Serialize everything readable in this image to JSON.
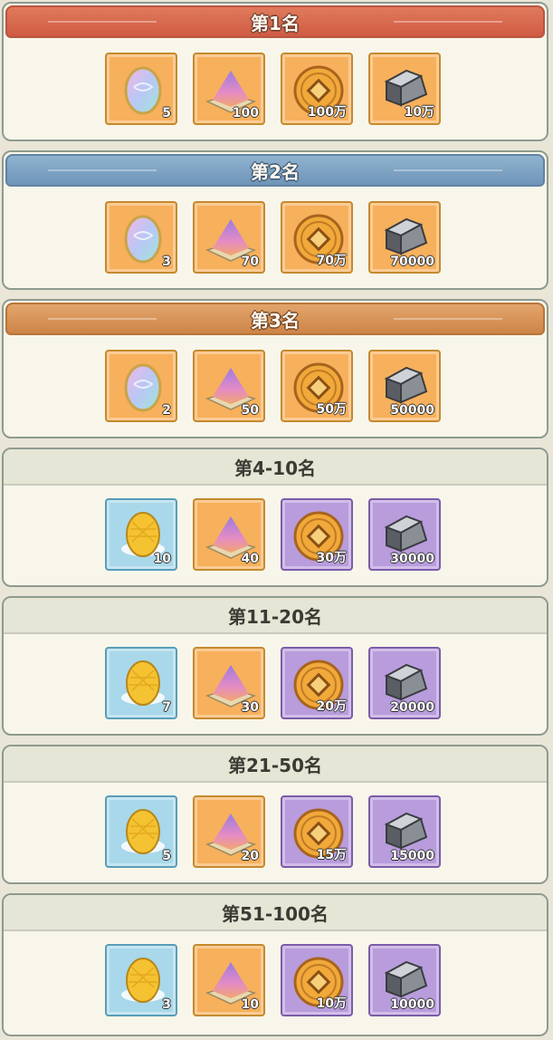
{
  "ranks": [
    {
      "title": "第1名",
      "style": "gold",
      "items": [
        {
          "icon": "rainbow-egg-icon",
          "bg": "orange",
          "qty": "5"
        },
        {
          "icon": "crystal-pile-icon",
          "bg": "orange",
          "qty": "100"
        },
        {
          "icon": "copper-coin-icon",
          "bg": "orange",
          "qty": "100万"
        },
        {
          "icon": "iron-ore-icon",
          "bg": "orange",
          "qty": "10万"
        }
      ]
    },
    {
      "title": "第2名",
      "style": "silver",
      "items": [
        {
          "icon": "rainbow-egg-icon",
          "bg": "orange",
          "qty": "3"
        },
        {
          "icon": "crystal-pile-icon",
          "bg": "orange",
          "qty": "70"
        },
        {
          "icon": "copper-coin-icon",
          "bg": "orange",
          "qty": "70万"
        },
        {
          "icon": "iron-ore-icon",
          "bg": "orange",
          "qty": "70000"
        }
      ]
    },
    {
      "title": "第3名",
      "style": "bronze",
      "items": [
        {
          "icon": "rainbow-egg-icon",
          "bg": "orange",
          "qty": "2"
        },
        {
          "icon": "crystal-pile-icon",
          "bg": "orange",
          "qty": "50"
        },
        {
          "icon": "copper-coin-icon",
          "bg": "orange",
          "qty": "50万"
        },
        {
          "icon": "iron-ore-icon",
          "bg": "orange",
          "qty": "50000"
        }
      ]
    },
    {
      "title": "第4-10名",
      "style": "plain",
      "items": [
        {
          "icon": "golden-egg-icon",
          "bg": "blue",
          "qty": "10"
        },
        {
          "icon": "crystal-pile-icon",
          "bg": "orange",
          "qty": "40"
        },
        {
          "icon": "copper-coin-icon",
          "bg": "purple",
          "qty": "30万"
        },
        {
          "icon": "iron-ore-icon",
          "bg": "purple",
          "qty": "30000"
        }
      ]
    },
    {
      "title": "第11-20名",
      "style": "plain",
      "items": [
        {
          "icon": "golden-egg-icon",
          "bg": "blue",
          "qty": "7"
        },
        {
          "icon": "crystal-pile-icon",
          "bg": "orange",
          "qty": "30"
        },
        {
          "icon": "copper-coin-icon",
          "bg": "purple",
          "qty": "20万"
        },
        {
          "icon": "iron-ore-icon",
          "bg": "purple",
          "qty": "20000"
        }
      ]
    },
    {
      "title": "第21-50名",
      "style": "plain",
      "items": [
        {
          "icon": "golden-egg-icon",
          "bg": "blue",
          "qty": "5"
        },
        {
          "icon": "crystal-pile-icon",
          "bg": "orange",
          "qty": "20"
        },
        {
          "icon": "copper-coin-icon",
          "bg": "purple",
          "qty": "15万"
        },
        {
          "icon": "iron-ore-icon",
          "bg": "purple",
          "qty": "15000"
        }
      ]
    },
    {
      "title": "第51-100名",
      "style": "plain",
      "items": [
        {
          "icon": "golden-egg-icon",
          "bg": "blue",
          "qty": "3"
        },
        {
          "icon": "crystal-pile-icon",
          "bg": "orange",
          "qty": "10"
        },
        {
          "icon": "copper-coin-icon",
          "bg": "purple",
          "qty": "10万"
        },
        {
          "icon": "iron-ore-icon",
          "bg": "purple",
          "qty": "10000"
        }
      ]
    }
  ]
}
